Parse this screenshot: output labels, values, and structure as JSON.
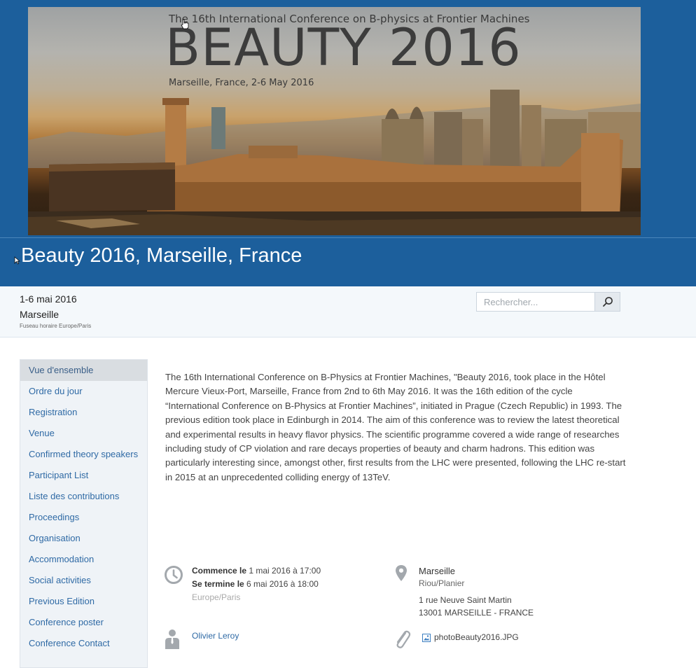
{
  "banner": {
    "subtitle": "The 16th International Conference on B-physics at Frontier Machines",
    "title": "BEAUTY 2016",
    "place": "Marseille, France, 2-6 May 2016"
  },
  "event": {
    "title": "Beauty 2016, Marseille, France",
    "date_range": "1-6 mai 2016",
    "location": "Marseille",
    "timezone": "Fuseau horaire Europe/Paris"
  },
  "search": {
    "placeholder": "Rechercher..."
  },
  "menu": {
    "items": [
      {
        "label": "Vue d'ensemble",
        "active": true
      },
      {
        "label": "Ordre du jour"
      },
      {
        "label": "Registration"
      },
      {
        "label": "Venue"
      },
      {
        "label": "Confirmed theory speakers"
      },
      {
        "label": "Participant List"
      },
      {
        "label": "Liste des contributions"
      },
      {
        "label": "Proceedings"
      },
      {
        "label": "Organisation"
      },
      {
        "label": "Accommodation"
      },
      {
        "label": "Social activities"
      },
      {
        "label": "Previous Edition"
      },
      {
        "label": "Conference poster"
      },
      {
        "label": "Conference Contact"
      }
    ]
  },
  "description": "The 16th International Conference on B-Physics at Frontier Machines, \"Beauty 2016, took place in the Hôtel Mercure Vieux-Port, Marseille, France from 2nd to 6th May 2016. It was the 16th edition of the cycle “International Conference on B-Physics at Frontier Machines”, initiated in Prague (Czech Republic) in 1993. The previous edition took place in Edinburgh in 2014. The aim of this conference was to review the latest theoretical and experimental results in heavy flavor physics. The scientific programme covered a wide range of researches including study of CP violation and rare decays properties of beauty and charm hadrons. This edition was particularly interesting since, amongst other,  first results from the LHC were presented, following the LHC re-start in 2015 at an unprecedented colliding energy of 13TeV.",
  "details": {
    "starts_label": "Commence le",
    "starts_value": "1 mai 2016 à 17:00",
    "ends_label": "Se termine le",
    "ends_value": "6 mai 2016 à 18:00",
    "timezone": "Europe/Paris",
    "venue_name": "Marseille",
    "venue_room": "Riou/Planier",
    "venue_street": "1 rue Neuve Saint Martin",
    "venue_city": "13001 MARSEILLE - FRANCE",
    "chair": "Olivier Leroy",
    "attachment": "photoBeauty2016.JPG"
  },
  "colors": {
    "header_blue": "#1c5f9c",
    "link_blue": "#2f6aa5",
    "sidebar_bg": "#eff3f7",
    "icon_gray": "#a3a8ad"
  },
  "icons": [
    "hand-cursor-icon",
    "arrow-cursor-icon",
    "search-icon",
    "clock-icon",
    "map-pin-icon",
    "person-icon",
    "paperclip-icon",
    "image-file-icon"
  ]
}
